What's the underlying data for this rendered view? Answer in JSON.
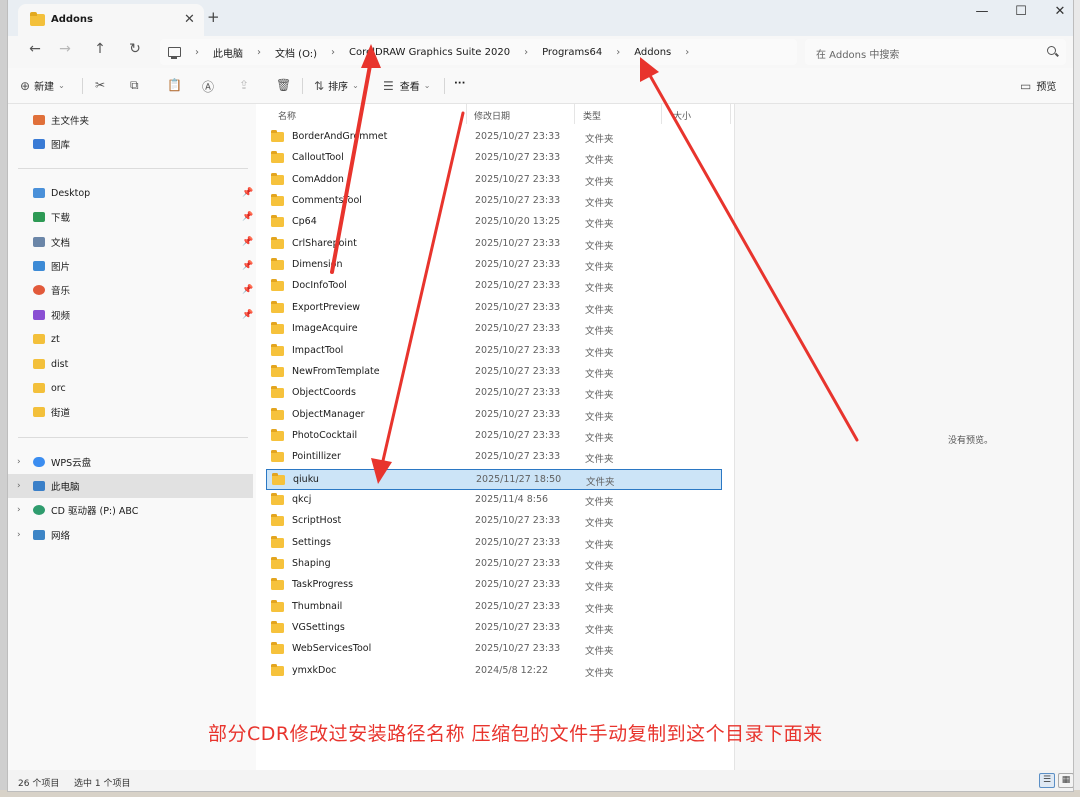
{
  "window": {
    "tab_title": "Addons",
    "tab_close": "✕",
    "new_tab": "+",
    "min": "—",
    "max": "☐",
    "close": "✕"
  },
  "nav": {
    "back": "←",
    "forward": "→",
    "up": "↑",
    "refresh": "↻"
  },
  "breadcrumb": [
    "此电脑",
    "文档 (O:)",
    "CorelDRAW Graphics Suite 2020",
    "Programs64",
    "Addons"
  ],
  "search": {
    "placeholder": "在 Addons 中搜索"
  },
  "toolbar": {
    "new_label": "新建",
    "sort_label": "排序",
    "view_label": "查看",
    "more": "···",
    "preview_label": "预览"
  },
  "sidebar": {
    "quick": [
      {
        "label": "主文件夹",
        "color": "#e0703a"
      },
      {
        "label": "图库",
        "color": "#3a7bd5"
      }
    ],
    "pinned": [
      {
        "label": "Desktop",
        "color": "#4a90d9"
      },
      {
        "label": "下载",
        "color": "#2e9a55"
      },
      {
        "label": "文档",
        "color": "#6b86a8"
      },
      {
        "label": "图片",
        "color": "#3d8bd6"
      },
      {
        "label": "音乐",
        "color": "#e25a3b"
      },
      {
        "label": "视频",
        "color": "#8a4fd3"
      }
    ],
    "folders": [
      "zt",
      "dist",
      "orc",
      "街道"
    ],
    "roots": [
      {
        "label": "WPS云盘",
        "color": "#3b8df0"
      },
      {
        "label": "此电脑",
        "color": "#3a7fc8"
      },
      {
        "label": "CD 驱动器 (P:) ABC",
        "color": "#2f9c6e"
      },
      {
        "label": "网络",
        "color": "#3d85c6"
      }
    ]
  },
  "columns": {
    "name": "名称",
    "date": "修改日期",
    "type": "类型",
    "size": "大小"
  },
  "files": [
    {
      "name": "BorderAndGrommet",
      "date": "2025/10/27 23:33",
      "type": "文件夹"
    },
    {
      "name": "CalloutTool",
      "date": "2025/10/27 23:33",
      "type": "文件夹"
    },
    {
      "name": "ComAddon",
      "date": "2025/10/27 23:33",
      "type": "文件夹"
    },
    {
      "name": "CommentsTool",
      "date": "2025/10/27 23:33",
      "type": "文件夹"
    },
    {
      "name": "Cp64",
      "date": "2025/10/20 13:25",
      "type": "文件夹"
    },
    {
      "name": "CrlSharepoint",
      "date": "2025/10/27 23:33",
      "type": "文件夹"
    },
    {
      "name": "Dimension",
      "date": "2025/10/27 23:33",
      "type": "文件夹"
    },
    {
      "name": "DocInfoTool",
      "date": "2025/10/27 23:33",
      "type": "文件夹"
    },
    {
      "name": "ExportPreview",
      "date": "2025/10/27 23:33",
      "type": "文件夹"
    },
    {
      "name": "ImageAcquire",
      "date": "2025/10/27 23:33",
      "type": "文件夹"
    },
    {
      "name": "ImpactTool",
      "date": "2025/10/27 23:33",
      "type": "文件夹"
    },
    {
      "name": "NewFromTemplate",
      "date": "2025/10/27 23:33",
      "type": "文件夹"
    },
    {
      "name": "ObjectCoords",
      "date": "2025/10/27 23:33",
      "type": "文件夹"
    },
    {
      "name": "ObjectManager",
      "date": "2025/10/27 23:33",
      "type": "文件夹"
    },
    {
      "name": "PhotoCocktail",
      "date": "2025/10/27 23:33",
      "type": "文件夹"
    },
    {
      "name": "Pointillizer",
      "date": "2025/10/27 23:33",
      "type": "文件夹"
    },
    {
      "name": "qiuku",
      "date": "2025/11/27 18:50",
      "type": "文件夹",
      "selected": true
    },
    {
      "name": "qkcj",
      "date": "2025/11/4 8:56",
      "type": "文件夹"
    },
    {
      "name": "ScriptHost",
      "date": "2025/10/27 23:33",
      "type": "文件夹"
    },
    {
      "name": "Settings",
      "date": "2025/10/27 23:33",
      "type": "文件夹"
    },
    {
      "name": "Shaping",
      "date": "2025/10/27 23:33",
      "type": "文件夹"
    },
    {
      "name": "TaskProgress",
      "date": "2025/10/27 23:33",
      "type": "文件夹"
    },
    {
      "name": "Thumbnail",
      "date": "2025/10/27 23:33",
      "type": "文件夹"
    },
    {
      "name": "VGSettings",
      "date": "2025/10/27 23:33",
      "type": "文件夹"
    },
    {
      "name": "WebServicesTool",
      "date": "2025/10/27 23:33",
      "type": "文件夹"
    },
    {
      "name": "ymxkDoc",
      "date": "2024/5/8 12:22",
      "type": "文件夹"
    }
  ],
  "preview": {
    "empty_text": "没有预览。"
  },
  "status": {
    "count": "26 个项目",
    "selected": "选中 1 个项目"
  },
  "annotation": {
    "text": "部分CDR修改过安装路径名称  压缩包的文件手动复制到这个目录下面来",
    "color": "#e8342d"
  }
}
